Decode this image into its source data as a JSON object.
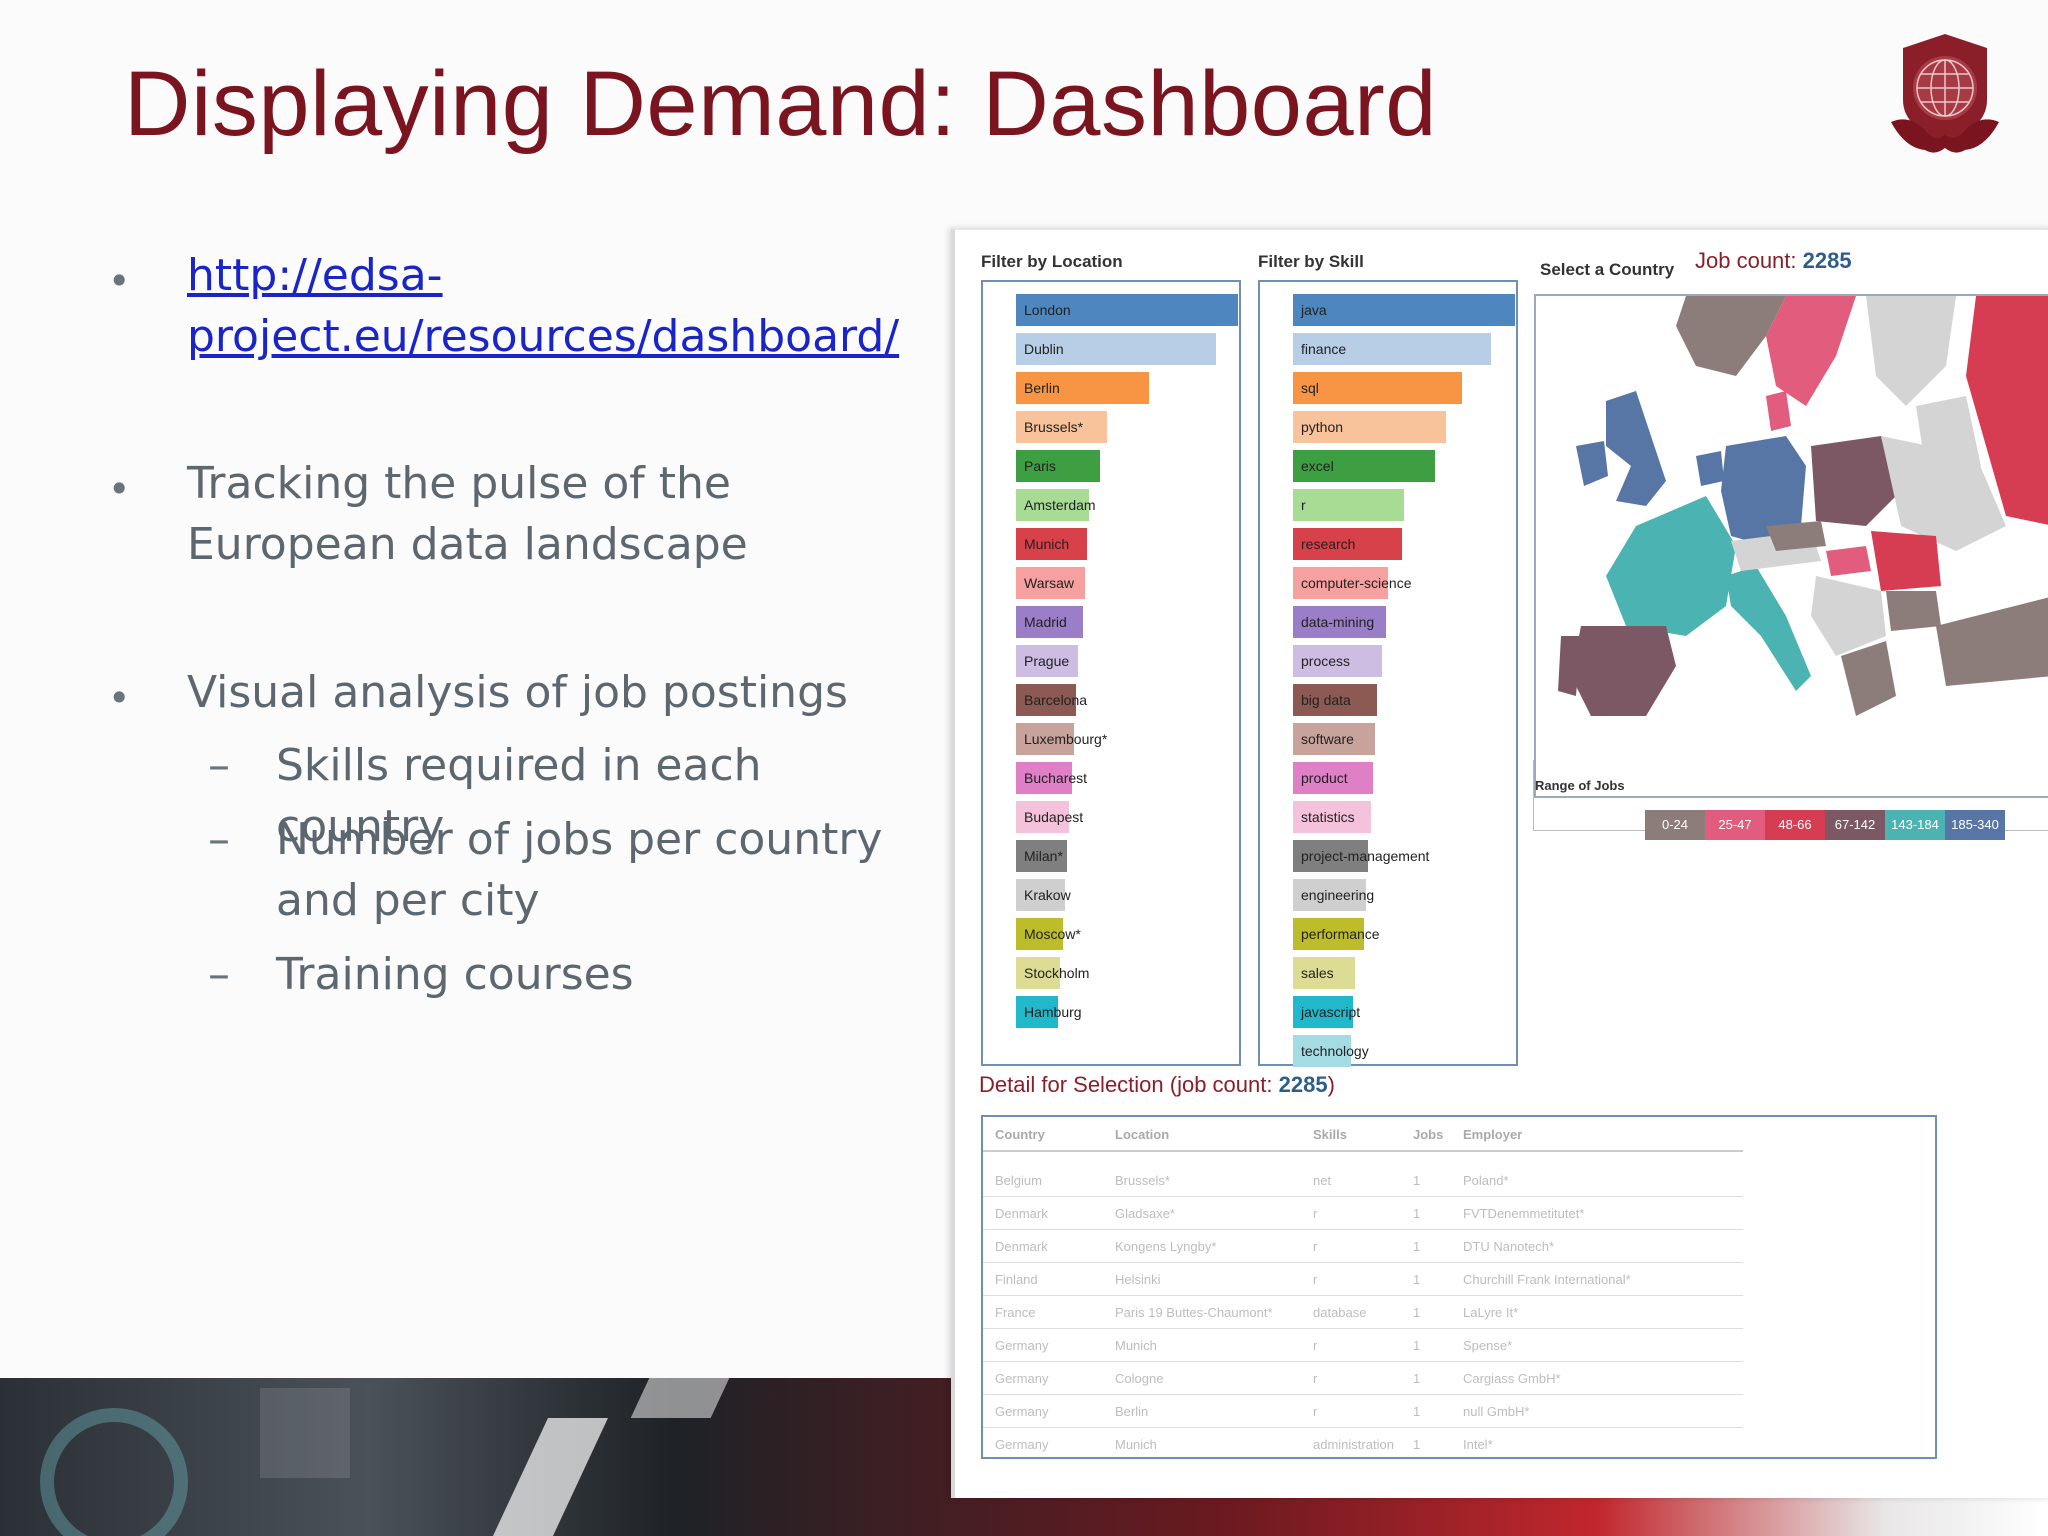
{
  "slide": {
    "title": "Displaying Demand: Dashboard",
    "bullets": [
      {
        "text_line1": "http://edsa-",
        "text_line2": "project.eu/resources/dashboard/"
      },
      {
        "text_line1": "Tracking the pulse of the",
        "text_line2": "European data landscape"
      },
      {
        "text": "Visual analysis of job postings"
      }
    ],
    "sub_bullets": [
      {
        "line1": "Skills required in each country"
      },
      {
        "line1": "Number of jobs per country",
        "line2": "and per city"
      },
      {
        "line1": "Training courses"
      }
    ],
    "bullet_glyph": "•",
    "dash_glyph": "–"
  },
  "dashboard": {
    "filter_location": {
      "title": "Filter by Location",
      "items": [
        {
          "label": "London",
          "value": 1.0,
          "color": "#4e87c0"
        },
        {
          "label": "Dublin",
          "value": 0.9,
          "color": "#b8cde6"
        },
        {
          "label": "Berlin",
          "value": 0.6,
          "color": "#f79545"
        },
        {
          "label": "Brussels*",
          "value": 0.41,
          "color": "#f8c29a"
        },
        {
          "label": "Paris",
          "value": 0.38,
          "color": "#3e9e42"
        },
        {
          "label": "Amsterdam",
          "value": 0.33,
          "color": "#a8dc95"
        },
        {
          "label": "Munich",
          "value": 0.32,
          "color": "#d8404a"
        },
        {
          "label": "Warsaw",
          "value": 0.31,
          "color": "#f7a0a0"
        },
        {
          "label": "Madrid",
          "value": 0.3,
          "color": "#9b7ec8"
        },
        {
          "label": "Prague",
          "value": 0.28,
          "color": "#cdbde2"
        },
        {
          "label": "Barcelona",
          "value": 0.27,
          "color": "#8c5a52"
        },
        {
          "label": "Luxembourg*",
          "value": 0.26,
          "color": "#c8a39b"
        },
        {
          "label": "Bucharest",
          "value": 0.25,
          "color": "#df7fc6"
        },
        {
          "label": "Budapest",
          "value": 0.24,
          "color": "#f5c2dc"
        },
        {
          "label": "Milan*",
          "value": 0.23,
          "color": "#7f7f7f"
        },
        {
          "label": "Krakow",
          "value": 0.22,
          "color": "#cfcfcf"
        },
        {
          "label": "Moscow*",
          "value": 0.21,
          "color": "#bdbd2c"
        },
        {
          "label": "Stockholm",
          "value": 0.2,
          "color": "#dcdc94"
        },
        {
          "label": "Hamburg",
          "value": 0.19,
          "color": "#22b8cc"
        }
      ]
    },
    "filter_skill": {
      "title": "Filter by Skill",
      "items": [
        {
          "label": "java",
          "value": 1.0,
          "color": "#4e87c0"
        },
        {
          "label": "finance",
          "value": 0.89,
          "color": "#b8cde6"
        },
        {
          "label": "sql",
          "value": 0.76,
          "color": "#f79545"
        },
        {
          "label": "python",
          "value": 0.69,
          "color": "#f8c29a"
        },
        {
          "label": "excel",
          "value": 0.64,
          "color": "#3e9e42"
        },
        {
          "label": "r",
          "value": 0.5,
          "color": "#a8dc95"
        },
        {
          "label": "research",
          "value": 0.49,
          "color": "#d8404a"
        },
        {
          "label": "computer-science",
          "value": 0.43,
          "color": "#f7a0a0"
        },
        {
          "label": "data-mining",
          "value": 0.42,
          "color": "#9b7ec8"
        },
        {
          "label": "process",
          "value": 0.4,
          "color": "#cdbde2"
        },
        {
          "label": "big data",
          "value": 0.38,
          "color": "#8c5a52"
        },
        {
          "label": "software",
          "value": 0.37,
          "color": "#c8a39b"
        },
        {
          "label": "product",
          "value": 0.36,
          "color": "#df7fc6"
        },
        {
          "label": "statistics",
          "value": 0.35,
          "color": "#f5c2dc"
        },
        {
          "label": "project-management",
          "value": 0.34,
          "color": "#7f7f7f"
        },
        {
          "label": "engineering",
          "value": 0.33,
          "color": "#cfcfcf"
        },
        {
          "label": "performance",
          "value": 0.32,
          "color": "#bdbd2c"
        },
        {
          "label": "sales",
          "value": 0.28,
          "color": "#dcdc94"
        },
        {
          "label": "javascript",
          "value": 0.27,
          "color": "#22b8cc"
        },
        {
          "label": "technology",
          "value": 0.26,
          "color": "#a5dbe3"
        }
      ]
    },
    "map": {
      "title": "Select a Country",
      "job_count_label": "Job count:",
      "job_count": "2285",
      "range_title": "Range of Jobs",
      "ranges": [
        {
          "label": "0-24",
          "color": "#8c7c7a"
        },
        {
          "label": "25-47",
          "color": "#e25d7d"
        },
        {
          "label": "48-66",
          "color": "#d63c52"
        },
        {
          "label": "67-142",
          "color": "#7c5864"
        },
        {
          "label": "143-184",
          "color": "#4bb4b2"
        },
        {
          "label": "185-340",
          "color": "#5776a6"
        }
      ]
    },
    "detail": {
      "title_prefix": "Detail for Selection (job count:",
      "job_count": "2285",
      "title_suffix": ")",
      "columns": [
        "Country",
        "Location",
        "Skills",
        "Jobs",
        "Employer"
      ],
      "rows": [
        [
          "Belgium",
          "Brussels*",
          "net",
          "1",
          "Poland*"
        ],
        [
          "Denmark",
          "Gladsaxe*",
          "r",
          "1",
          "FVTDenemmetitutet*"
        ],
        [
          "Denmark",
          "Kongens Lyngby*",
          "r",
          "1",
          "DTU Nanotech*"
        ],
        [
          "Finland",
          "Helsinki",
          "r",
          "1",
          "Churchill Frank International*"
        ],
        [
          "France",
          "Paris 19 Buttes-Chaumont*",
          "database",
          "1",
          "LaLyre It*"
        ],
        [
          "Germany",
          "Munich",
          "r",
          "1",
          "Spense*"
        ],
        [
          "Germany",
          "Cologne",
          "r",
          "1",
          "Cargiass GmbH*"
        ],
        [
          "Germany",
          "Berlin",
          "r",
          "1",
          "null GmbH*"
        ],
        [
          "Germany",
          "Munich",
          "administration",
          "1",
          "Intel*"
        ]
      ]
    }
  }
}
